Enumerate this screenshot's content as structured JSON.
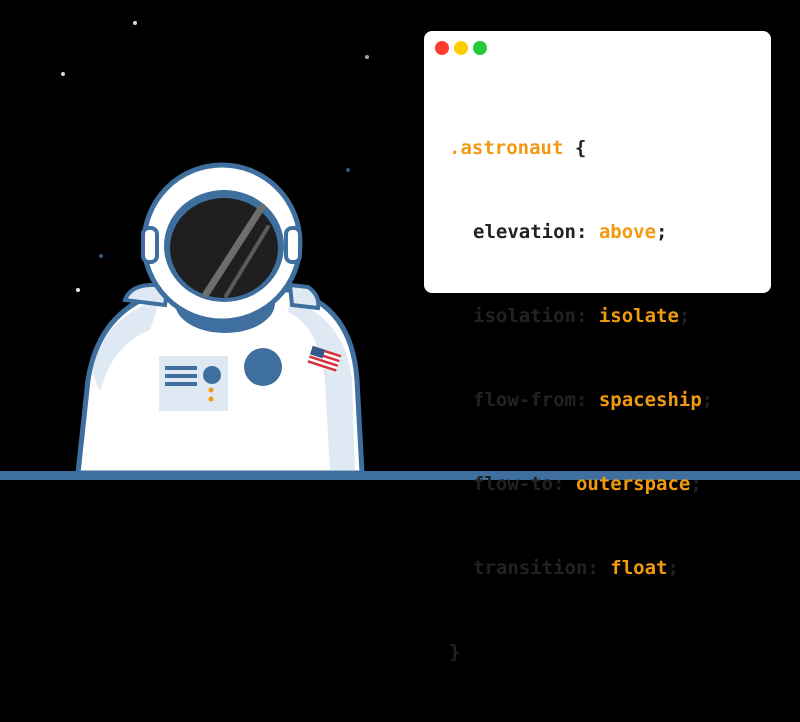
{
  "colors": {
    "background": "#000000",
    "ground": "#3f6f9e",
    "window_bg": "#ffffff",
    "dot_close": "#ff3b30",
    "dot_minimize": "#ffcc00",
    "dot_maximize": "#27c93f",
    "code_text": "#222222",
    "code_accent": "#f29a0f",
    "suit": "#ffffff",
    "suit_shadow": "#dfe9f4",
    "suit_outline": "#3f6f9e",
    "visor": "#1f1f1f"
  },
  "code": {
    "selector": ".astronaut",
    "open_brace": " {",
    "close_brace": "}",
    "declarations": [
      {
        "property": "elevation",
        "value": "above"
      },
      {
        "property": "isolation",
        "value": "isolate"
      },
      {
        "property": "flow-from",
        "value": "spaceship"
      },
      {
        "property": "flow-to",
        "value": "outerspace"
      },
      {
        "property": "transition",
        "value": "float"
      }
    ]
  },
  "illustration": {
    "name": "astronaut",
    "icons": [
      "helmet-icon",
      "visor-icon",
      "chest-panel-icon",
      "flag-icon"
    ]
  }
}
